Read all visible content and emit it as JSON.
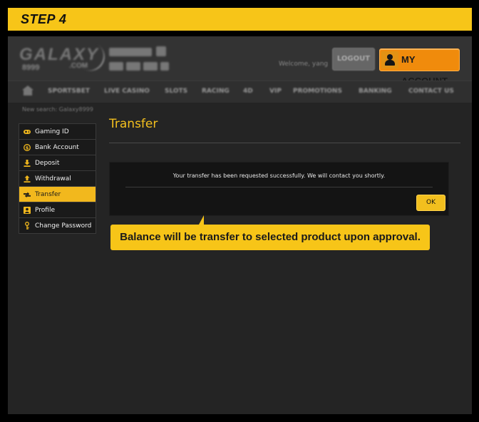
{
  "step": {
    "label": "STEP 4"
  },
  "header": {
    "logo": {
      "main": "GALAXY",
      "sub": "8999",
      "suffix": ".COM"
    },
    "welcome_text": "Welcome, yang",
    "logout_label": "LOGOUT",
    "my_account_label": "MY ACCOUNT"
  },
  "nav": {
    "items": [
      "SPORTSBET",
      "LIVE CASINO",
      "SLOTS",
      "RACING",
      "4D",
      "VIP",
      "PROMOTIONS",
      "BANKING",
      "CONTACT US"
    ]
  },
  "breadcrumb": "New search: Galaxy8999",
  "sidebar": {
    "items": [
      {
        "label": "Gaming ID",
        "icon": "gamepad-icon",
        "active": false
      },
      {
        "label": "Bank Account",
        "icon": "coin-icon",
        "active": false
      },
      {
        "label": "Deposit",
        "icon": "download-icon",
        "active": false
      },
      {
        "label": "Withdrawal",
        "icon": "upload-icon",
        "active": false
      },
      {
        "label": "Transfer",
        "icon": "transfer-icon",
        "active": true
      },
      {
        "label": "Profile",
        "icon": "profile-icon",
        "active": false
      },
      {
        "label": "Change Password",
        "icon": "key-icon",
        "active": false
      }
    ]
  },
  "content": {
    "title": "Transfer",
    "dialog": {
      "message": "Your transfer has been requested successfully. We will contact you shortly.",
      "ok_label": "OK"
    }
  },
  "callout": {
    "text": "Balance will be transfer to selected product upon approval."
  },
  "colors": {
    "accent": "#f7c518",
    "account_button": "#f08b0c",
    "frame_bg": "#242424"
  }
}
